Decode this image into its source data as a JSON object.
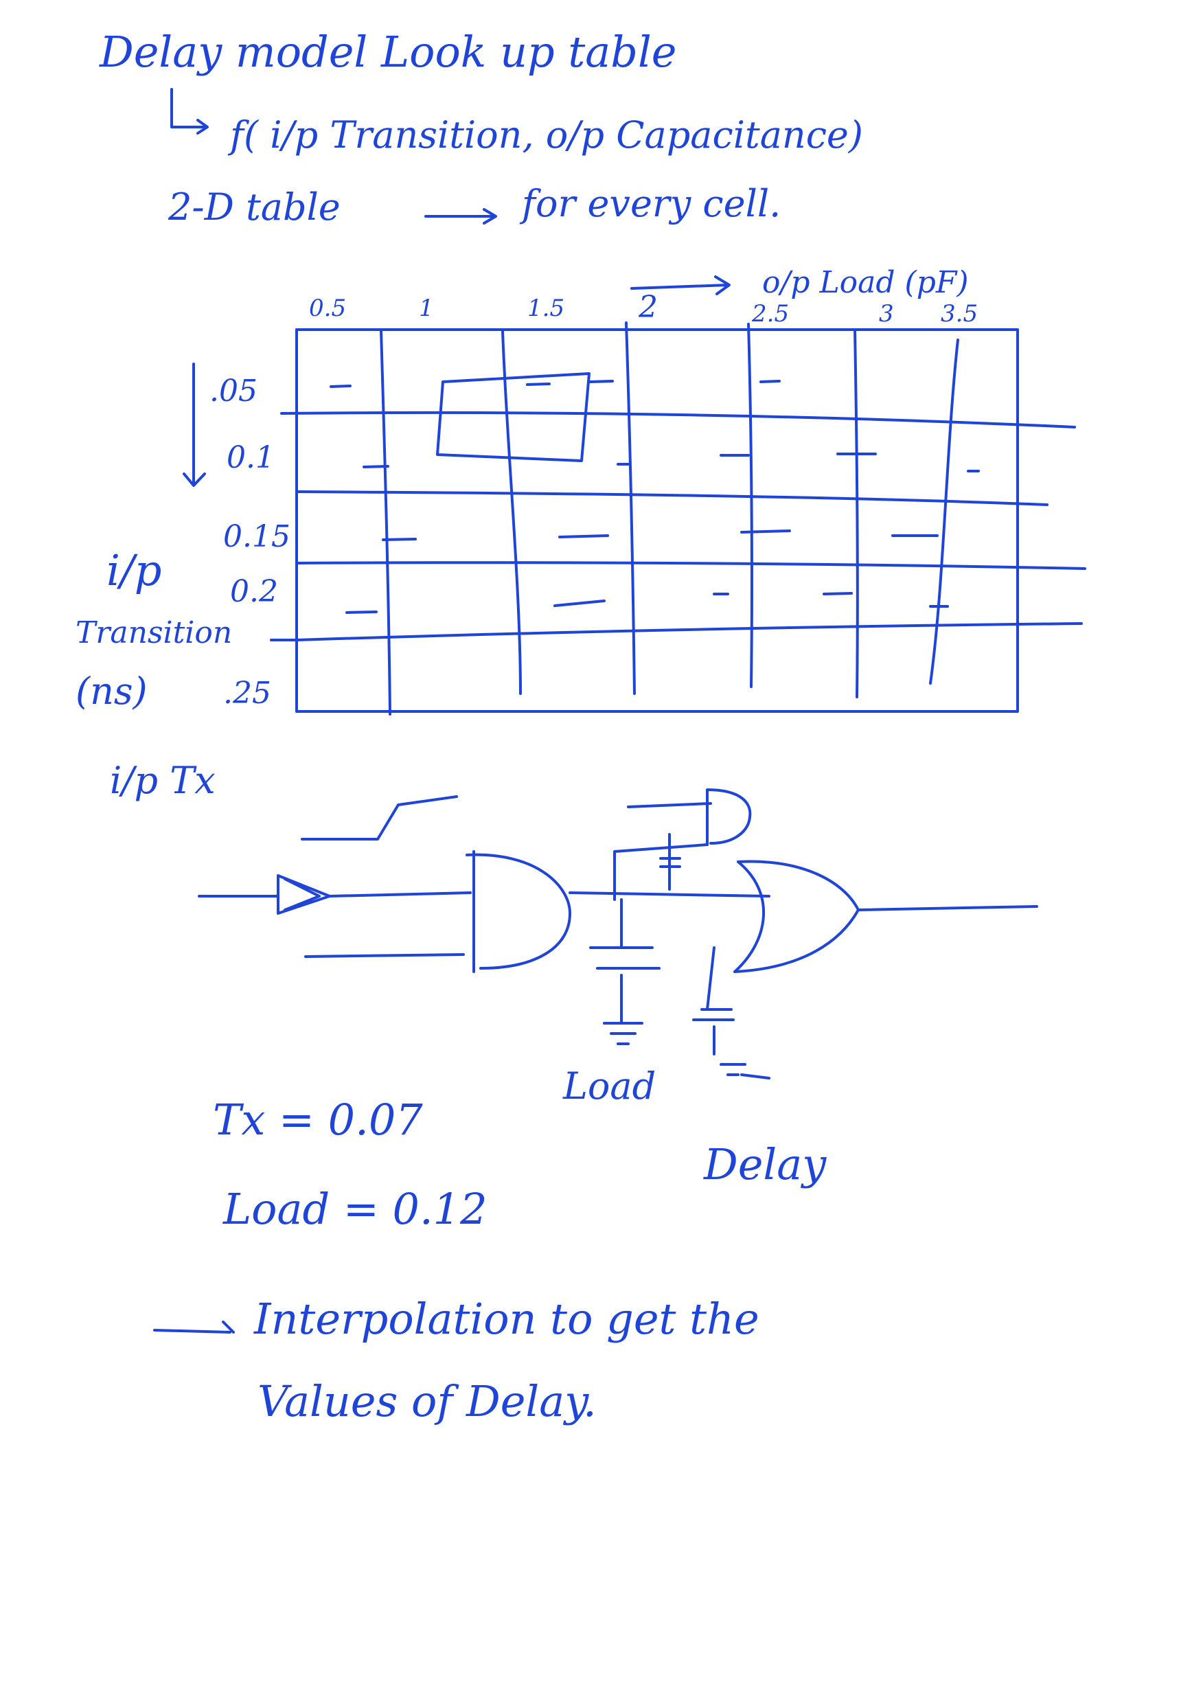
{
  "heading": {
    "line1": "Delay model  Look up table",
    "line2_arrow": "↳",
    "line2": "f( i/p Transition,  o/p Capacitance)",
    "line3_left": "2-D table",
    "line3_right": "for every cell."
  },
  "table": {
    "col_axis_label": "o/p Load (pF)",
    "col_labels": [
      "0.5",
      "1",
      "1.5",
      "2",
      "2.5",
      "3",
      "3.5"
    ],
    "row_labels": [
      ".05",
      "0.1",
      "0.15",
      "0.2",
      ".25"
    ],
    "row_axis_label_1": "i/p",
    "row_axis_label_2": "Transition",
    "row_axis_label_3": "(ns)"
  },
  "circuit": {
    "input_label": "i/p Tx",
    "load_label": "Load",
    "delay_label": "Delay"
  },
  "values": {
    "tx": "Tx = 0.07",
    "load": "Load = 0.12"
  },
  "notes": {
    "interp_line1": "Interpolation to get the",
    "interp_line2": "Values of Delay."
  }
}
